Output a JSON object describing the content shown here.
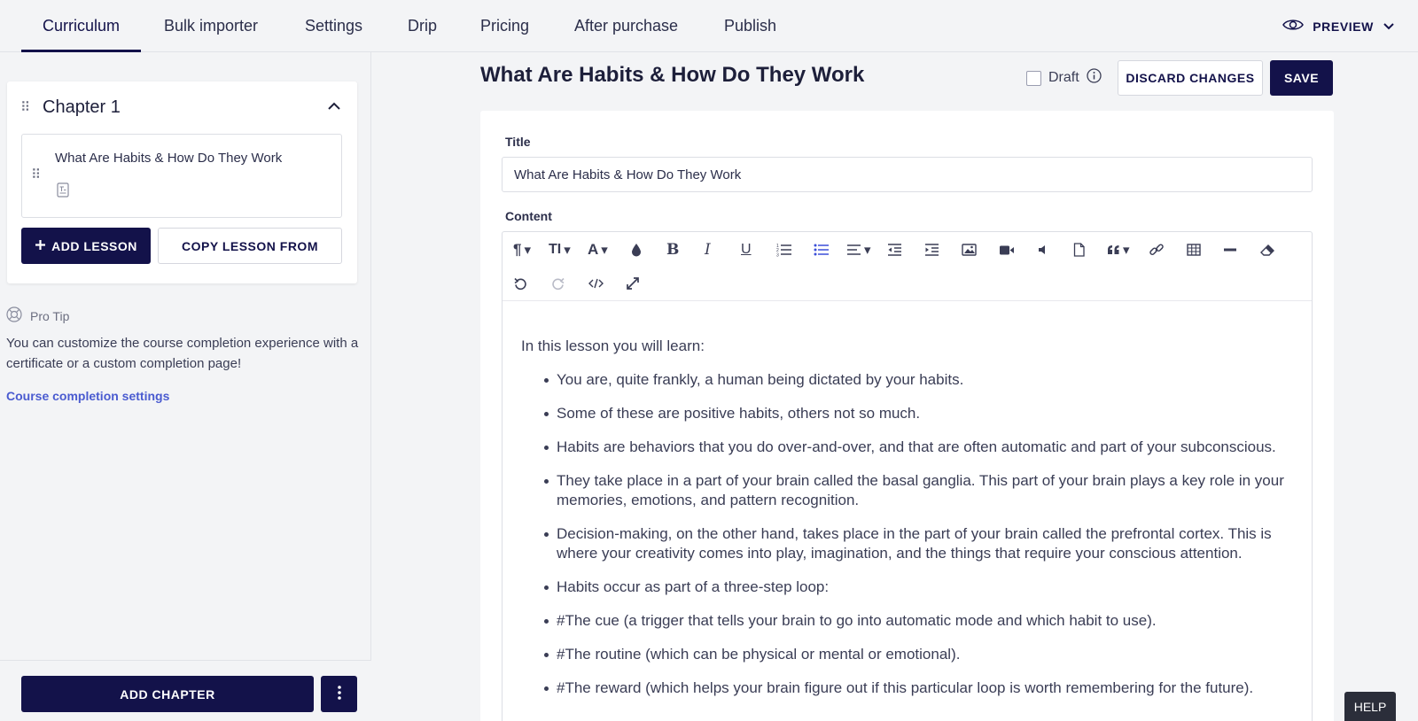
{
  "nav": {
    "tabs": [
      {
        "label": "Curriculum",
        "active": true
      },
      {
        "label": "Bulk importer"
      },
      {
        "label": "Settings"
      },
      {
        "label": "Drip"
      },
      {
        "label": "Pricing"
      },
      {
        "label": "After purchase"
      },
      {
        "label": "Publish"
      }
    ],
    "preview_label": "PREVIEW",
    "preview_icon": "eye-icon"
  },
  "sidebar": {
    "chapter": {
      "title": "Chapter 1",
      "lessons": [
        {
          "title": "What Are Habits & How Do They Work",
          "type_icon": "text-lesson-icon"
        }
      ]
    },
    "add_lesson_label": "ADD LESSON",
    "copy_lesson_label": "COPY LESSON FROM",
    "pro_tip": {
      "label": "Pro Tip",
      "text": "You can customize the course completion experience with a certificate or a custom completion page!",
      "link": "Course completion settings"
    },
    "add_chapter_label": "ADD CHAPTER"
  },
  "main": {
    "page_title": "What Are Habits & How Do They Work",
    "draft_label": "Draft",
    "draft_checked": false,
    "discard_label": "DISCARD CHANGES",
    "save_label": "SAVE",
    "title_label": "Title",
    "title_value": "What Are Habits & How Do They Work",
    "content_label": "Content",
    "content": {
      "intro": "In this lesson you will learn:",
      "bullets": [
        "You are, quite frankly, a human being dictated by your habits.",
        "Some of these are positive habits, others not so much.",
        "Habits are behaviors that you do over-and-over, and that are often automatic and part of your subconscious.",
        "They take place in a part of your brain called the basal ganglia. This part of your brain plays a key role in your memories, emotions, and pattern recognition.",
        "Decision-making, on the other hand, takes place in the part of your brain called the prefrontal cortex. This is where your creativity comes into play, imagination, and the things that require your conscious attention.",
        "Habits occur as part of a three-step loop:",
        "#The cue (a trigger that tells your brain to go into automatic mode and which habit to use).",
        "#The routine (which can be physical or mental or emotional).",
        "#The reward (which helps your brain figure out if this particular loop is worth remembering for the future)."
      ]
    }
  },
  "help_label": "HELP",
  "colors": {
    "primary": "#13124a",
    "link": "#4a5bd0",
    "active_tool": "#3b4fd8"
  }
}
